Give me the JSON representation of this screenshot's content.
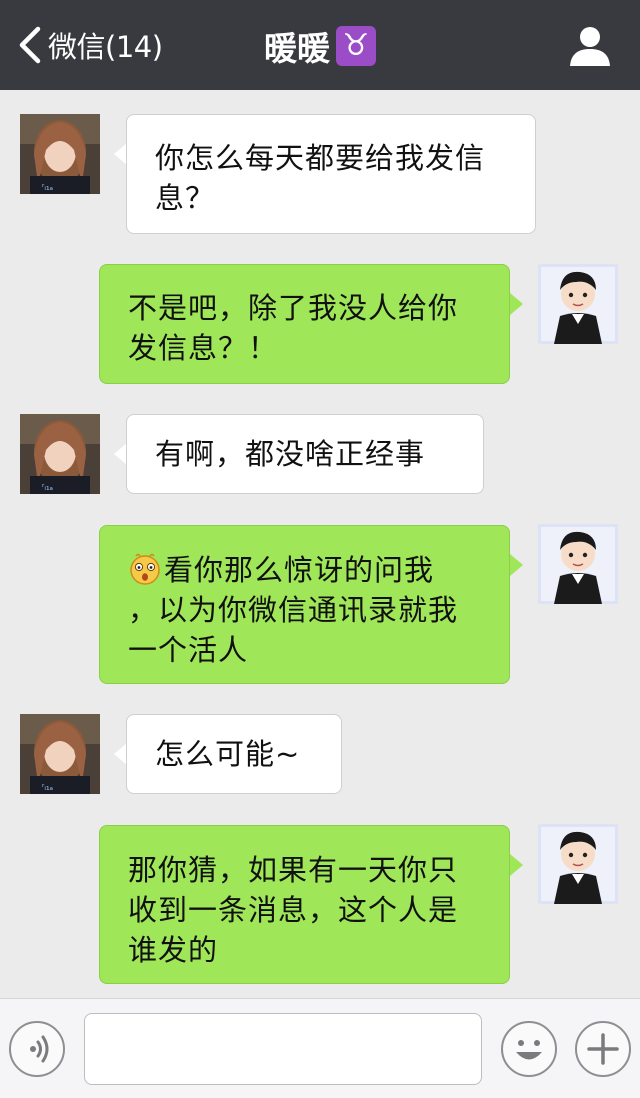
{
  "header": {
    "back_label": "微信(14)",
    "title": "暖暖",
    "zodiac_symbol": "♉",
    "zodiac_color": "#9b4dc8",
    "profile_icon": "person-icon"
  },
  "messages": [
    {
      "side": "left",
      "text": "你怎么每天都要给我发信息？",
      "lines": [
        "你怎么每天都要给我发信",
        "息？"
      ]
    },
    {
      "side": "right",
      "text": "不是吧，除了我没人给你发信息？！",
      "lines": [
        "不是吧，除了我没人给你",
        "发信息？！"
      ]
    },
    {
      "side": "left",
      "text": "有啊，都没啥正经事",
      "lines": [
        "有啊，都没啥正经事"
      ]
    },
    {
      "side": "right",
      "text": "看你那么惊讶的问我，以为你微信通讯录就我一个活人",
      "emoji": "surprised-face-icon",
      "lines": [
        "看你那么惊讶的问我",
        "，以为你微信通讯录就我",
        "一个活人"
      ]
    },
    {
      "side": "left",
      "text": "怎么可能~",
      "lines": [
        "怎么可能~"
      ]
    },
    {
      "side": "right",
      "text": "那你猜，如果有一天你只收到一条消息，这个人是谁发的",
      "lines": [
        "那你猜，如果有一天你只",
        "收到一条消息，这个人是",
        "谁发的"
      ]
    }
  ],
  "inputbar": {
    "voice_icon": "voice-icon",
    "text_value": "",
    "emoji_icon": "smiley-icon",
    "more_icon": "plus-icon"
  },
  "colors": {
    "header_bg": "#393a3f",
    "chat_bg": "#ebebeb",
    "bubble_sent": "#9fe658",
    "bubble_received": "#ffffff"
  }
}
